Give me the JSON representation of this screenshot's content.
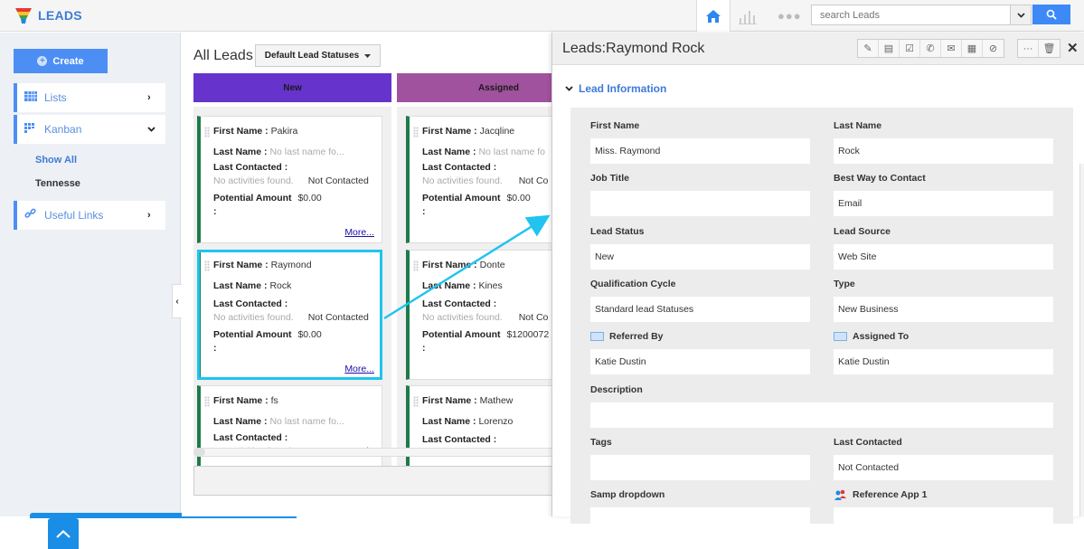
{
  "app": {
    "title": "LEADS"
  },
  "topbar": {
    "home_icon": "home-icon",
    "chart_icon": "bar-chart-icon",
    "more_icon": "ellipsis-icon",
    "search_placeholder": "search Leads",
    "search_icon": "search-icon"
  },
  "sidebar": {
    "create_label": "Create",
    "items": [
      {
        "label": "Lists",
        "icon": "grid-icon",
        "state": "collapsed"
      },
      {
        "label": "Kanban",
        "icon": "kanban-icon",
        "state": "expanded"
      },
      {
        "label": "Useful Links",
        "icon": "link-icon",
        "state": "collapsed"
      }
    ],
    "kanban_sub": [
      {
        "label": "Show All",
        "active": true
      },
      {
        "label": "Tennesse",
        "active": false
      }
    ]
  },
  "main": {
    "title": "All Leads",
    "status_select": "Default Lead Statuses",
    "columns": [
      {
        "name": "New",
        "color": "#6633cc",
        "cards": [
          {
            "first_name": "Pakira",
            "last_name": "No last name fo...",
            "last_name_empty": true,
            "last_contacted_activity": "No activities found.",
            "last_contacted_status": "Not Contacted",
            "potential_amount": "$0.00",
            "more": "More..."
          },
          {
            "first_name": "Raymond",
            "last_name": "Rock",
            "last_name_empty": false,
            "last_contacted_activity": "No activities found.",
            "last_contacted_status": "Not Contacted",
            "potential_amount": "$0.00",
            "more": "More...",
            "selected": true
          },
          {
            "first_name": "fs",
            "last_name": "No last name fo...",
            "last_name_empty": true,
            "last_contacted_activity": "No activities found.",
            "last_contacted_status": "Not Contacted"
          }
        ]
      },
      {
        "name": "Assigned",
        "color": "#a0529e",
        "cards": [
          {
            "first_name": "Jacqline",
            "last_name": "No last name fo",
            "last_name_empty": true,
            "last_contacted_activity": "No activities found.",
            "last_contacted_status": "Not Co",
            "potential_amount": "$0.00"
          },
          {
            "first_name": "Donte",
            "last_name": "Kines",
            "last_name_empty": false,
            "last_contacted_activity": "No activities found.",
            "last_contacted_status": "Not Co",
            "potential_amount": "$1200072"
          },
          {
            "first_name": "Mathew",
            "last_name": "Lorenzo",
            "last_name_empty": false
          }
        ]
      }
    ],
    "labels": {
      "first_name": "First Name :",
      "last_name": "Last Name :",
      "last_contacted": "Last Contacted :",
      "potential_amount": "Potential Amount",
      "colon": ":"
    }
  },
  "detail": {
    "title": "Leads:Raymond Rock",
    "toolbar": [
      {
        "icon": "pin-icon",
        "glyph": "✎"
      },
      {
        "icon": "calendar-icon",
        "glyph": "▤"
      },
      {
        "icon": "task-check-icon",
        "glyph": "☑"
      },
      {
        "icon": "phone-icon",
        "glyph": "✆"
      },
      {
        "icon": "mail-icon",
        "glyph": "✉"
      },
      {
        "icon": "note-icon",
        "glyph": "▦"
      },
      {
        "icon": "attachment-icon",
        "glyph": "⊘"
      }
    ],
    "toolbar2": [
      {
        "icon": "more-icon",
        "glyph": "···"
      },
      {
        "icon": "trash-icon",
        "glyph": "🗑"
      }
    ],
    "close_glyph": "✕",
    "section": "Lead Information",
    "fields": [
      {
        "label": "First Name",
        "value": "Miss. Raymond"
      },
      {
        "label": "Last Name",
        "value": "Rock"
      },
      {
        "label": "Job Title",
        "value": ""
      },
      {
        "label": "Best Way to Contact",
        "value": "Email"
      },
      {
        "label": "Lead Status",
        "value": "New"
      },
      {
        "label": "Lead Source",
        "value": "Web Site"
      },
      {
        "label": "Qualification Cycle",
        "value": "Standard lead Statuses"
      },
      {
        "label": "Type",
        "value": "New Business"
      },
      {
        "label": "Referred By",
        "value": "Katie Dustin",
        "icon": "contact-card-icon"
      },
      {
        "label": "Assigned To",
        "value": "Katie Dustin",
        "icon": "contact-card-icon"
      },
      {
        "label": "Description",
        "value": ""
      },
      {
        "label": "Tags",
        "value": ""
      },
      {
        "label": "Last Contacted",
        "value": "Not Contacted"
      },
      {
        "label": "Samp dropdown",
        "value": ""
      },
      {
        "label": "Reference App 1",
        "value": "",
        "icon": "reference-users-icon"
      }
    ]
  },
  "colors": {
    "accent": "#3d8af7",
    "card_border": "#1f7a4a",
    "selection": "#20c4ee"
  }
}
